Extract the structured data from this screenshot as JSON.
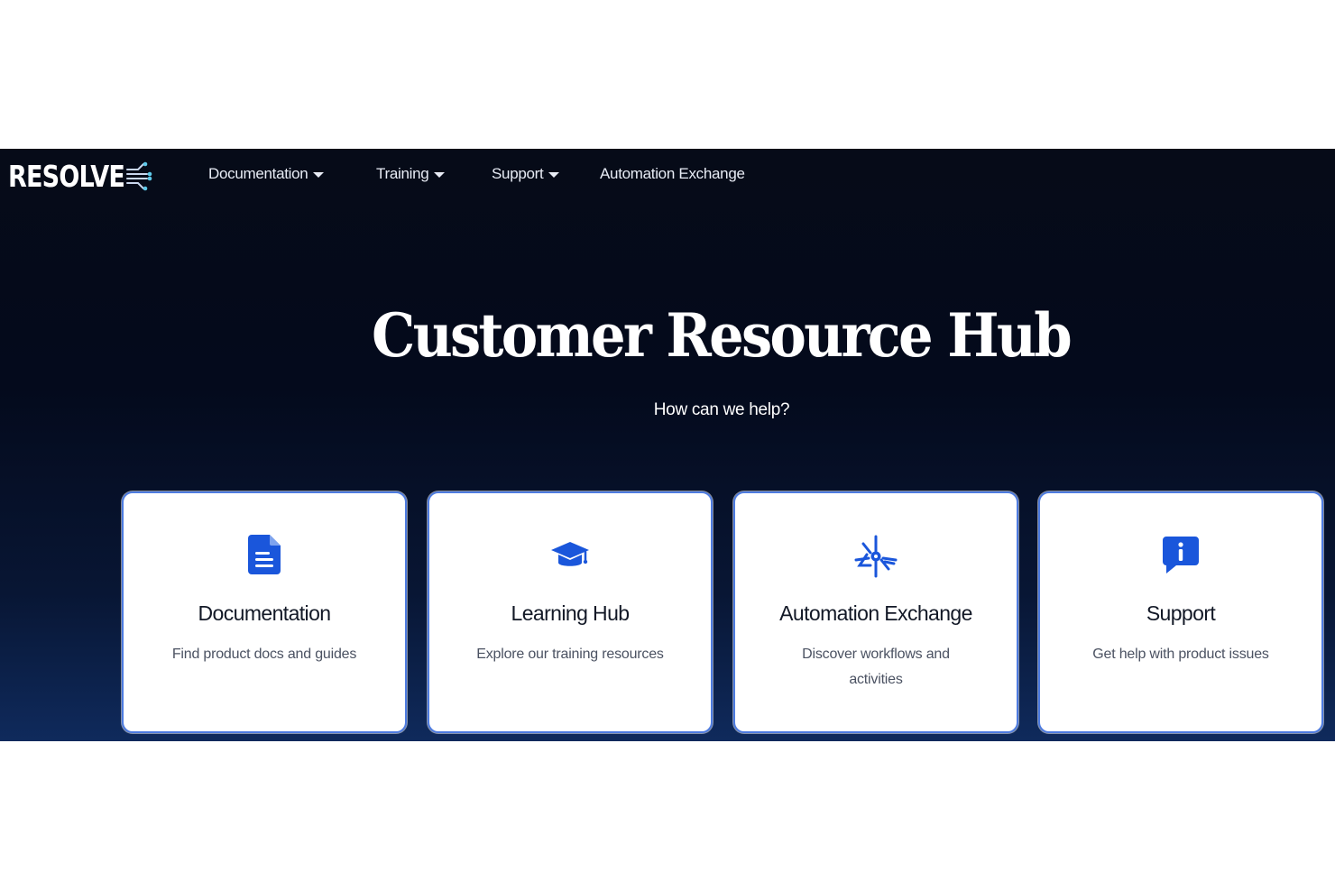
{
  "brand": {
    "logo_text": "RESOLVE",
    "logo_icon": "circuit-arrows-icon"
  },
  "nav": {
    "items": [
      {
        "label": "Documentation",
        "has_dropdown": true
      },
      {
        "label": "Training",
        "has_dropdown": true
      },
      {
        "label": "Support",
        "has_dropdown": true
      },
      {
        "label": "Automation Exchange",
        "has_dropdown": false
      }
    ]
  },
  "hero": {
    "title": "Customer Resource Hub",
    "subtitle": "How can we help?"
  },
  "cards": [
    {
      "title": "Documentation",
      "description": "Find product docs and guides",
      "icon": "document-icon"
    },
    {
      "title": "Learning Hub",
      "description": "Explore our training resources",
      "icon": "graduation-cap-icon"
    },
    {
      "title": "Automation Exchange",
      "description": "Discover workflows and activities",
      "icon": "automation-hub-icon"
    },
    {
      "title": "Support",
      "description": "Get help with product issues",
      "icon": "info-message-icon"
    }
  ],
  "colors": {
    "accent": "#1a56db",
    "card_border": "#4d7be0",
    "hero_bg": "#050b1c"
  }
}
